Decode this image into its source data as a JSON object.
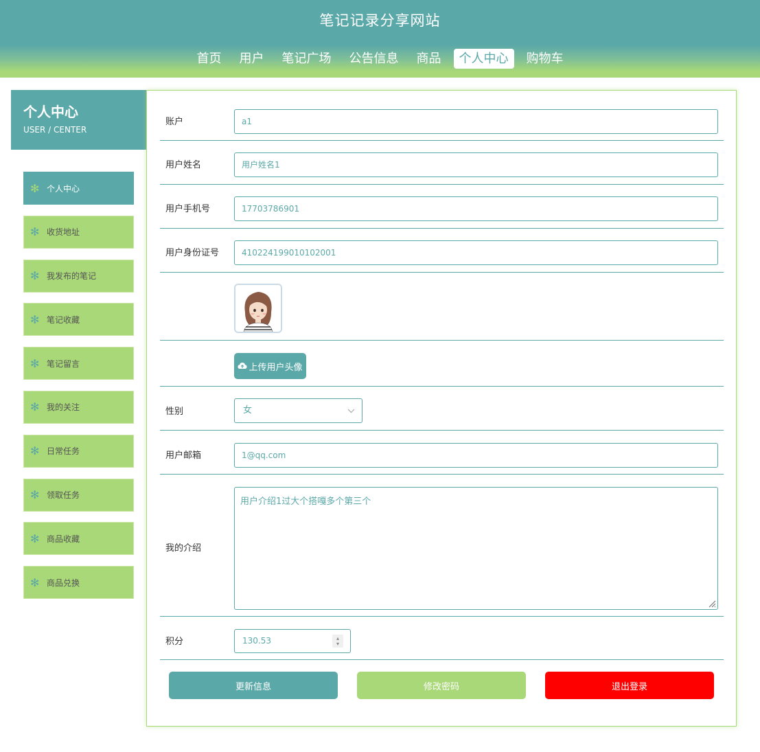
{
  "site": {
    "title": "笔记记录分享网站"
  },
  "nav": {
    "items": [
      "首页",
      "用户",
      "笔记广场",
      "公告信息",
      "商品",
      "个人中心",
      "购物车"
    ],
    "active_index": 5
  },
  "sidebar": {
    "title": "个人中心",
    "subtitle": "USER / CENTER",
    "items": [
      "个人中心",
      "收货地址",
      "我发布的笔记",
      "笔记收藏",
      "笔记留言",
      "我的关注",
      "日常任务",
      "领取任务",
      "商品收藏",
      "商品兑换"
    ],
    "active_index": 0
  },
  "form": {
    "account": {
      "label": "账户",
      "value": "a1"
    },
    "name": {
      "label": "用户姓名",
      "value": "用户姓名1"
    },
    "phone": {
      "label": "用户手机号",
      "value": "17703786901"
    },
    "id_card": {
      "label": "用户身份证号",
      "value": "410224199010102001"
    },
    "upload_label": "上传用户头像",
    "gender": {
      "label": "性别",
      "value": "女"
    },
    "email": {
      "label": "用户邮箱",
      "value": "1@qq.com"
    },
    "intro": {
      "label": "我的介绍",
      "value": "用户介绍1过大个搭嘎多个第三个"
    },
    "points": {
      "label": "积分",
      "value": "130.53"
    }
  },
  "actions": {
    "update": "更新信息",
    "change_password": "修改密码",
    "logout": "退出登录"
  },
  "colors": {
    "primary": "#5ba8a8",
    "accent": "#a8d877",
    "danger": "#ff0000"
  }
}
